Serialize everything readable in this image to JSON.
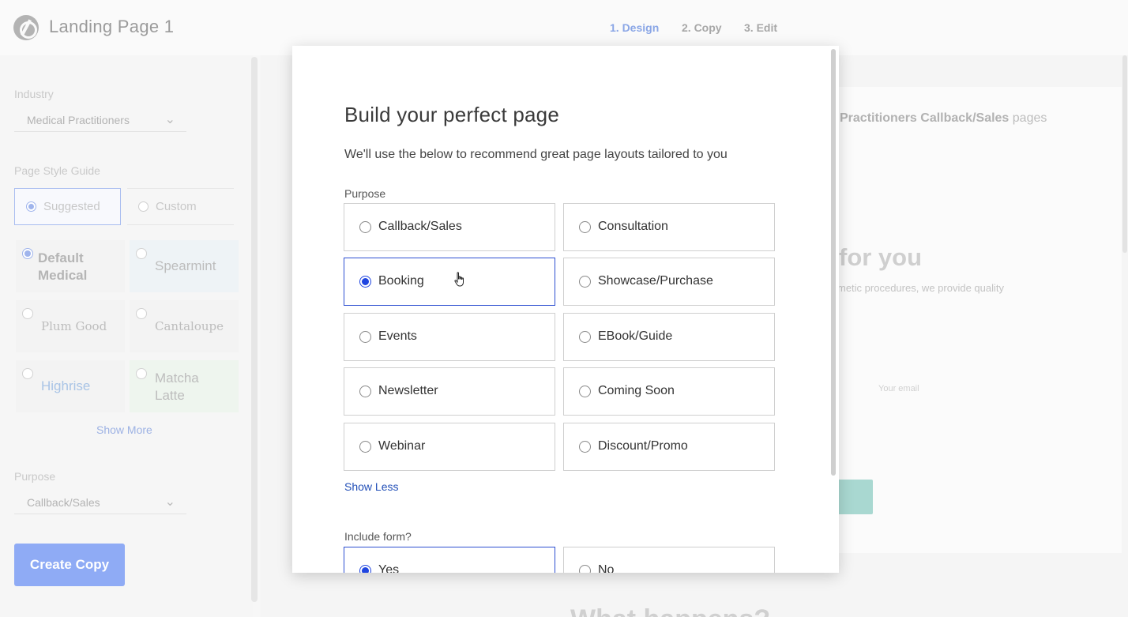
{
  "app": {
    "title": "Landing Page 1"
  },
  "steps": [
    "1. Design",
    "2. Copy",
    "3. Edit"
  ],
  "sidebar": {
    "industry_label": "Industry",
    "industry_value": "Medical Practitioners",
    "style_label": "Page Style Guide",
    "style_options": [
      "Suggested",
      "Custom"
    ],
    "themes": [
      {
        "name": "Default Medical",
        "selected": true
      },
      {
        "name": "Spearmint"
      },
      {
        "name": "Plum Good"
      },
      {
        "name": "Cantaloupe"
      },
      {
        "name": "Highrise"
      },
      {
        "name": "Matcha Latte"
      }
    ],
    "show_more": "Show More",
    "purpose_label": "Purpose",
    "purpose_value": "Callback/Sales",
    "create_copy": "Create Copy"
  },
  "preview": {
    "heading_bold": "Practitioners Callback/Sales",
    "heading_rest": " pages",
    "hero_text": "for you",
    "desc": "metic procedures, we provide quality",
    "email_placeholder": "Your email",
    "bottom_text": "What happens?"
  },
  "modal": {
    "title": "Build your perfect page",
    "subtitle": "We'll use the below to recommend great page layouts tailored to you",
    "purpose_label": "Purpose",
    "purpose_options": [
      "Callback/Sales",
      "Consultation",
      "Booking",
      "Showcase/Purchase",
      "Events",
      "EBook/Guide",
      "Newsletter",
      "Coming Soon",
      "Webinar",
      "Discount/Promo"
    ],
    "purpose_selected": "Booking",
    "show_less": "Show Less",
    "form_label": "Include form?",
    "form_options": [
      "Yes",
      "No"
    ],
    "form_selected": "Yes"
  },
  "colors": {
    "accent": "#1f45e0",
    "link": "#2350b8",
    "create_copy_bg": "#8fabf5"
  }
}
